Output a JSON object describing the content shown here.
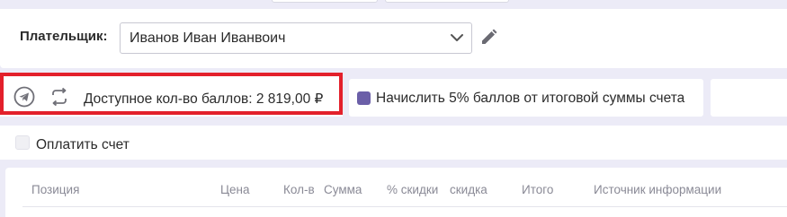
{
  "payer": {
    "label": "Плательщик:",
    "selected": "Иванов Иван Иванвоич"
  },
  "points": {
    "available_text": "Доступное кол-во баллов: 2 819,00 ₽"
  },
  "accrue": {
    "checked": true,
    "label": "Начислить 5% баллов от итоговой суммы счета"
  },
  "pay_invoice": {
    "checked": false,
    "label": "Оплатить счет"
  },
  "table": {
    "columns": [
      "Позиция",
      "Цена",
      "Кол-в",
      "Сумма",
      "% скидки",
      "скидка",
      "Итого",
      "Источник информации"
    ]
  },
  "colors": {
    "accent": "#6b5fa8",
    "highlight": "#e3202b",
    "background": "#ecebf7"
  },
  "icons": [
    "telegram-icon",
    "sync-icon",
    "edit-icon",
    "chevron-down-icon"
  ]
}
